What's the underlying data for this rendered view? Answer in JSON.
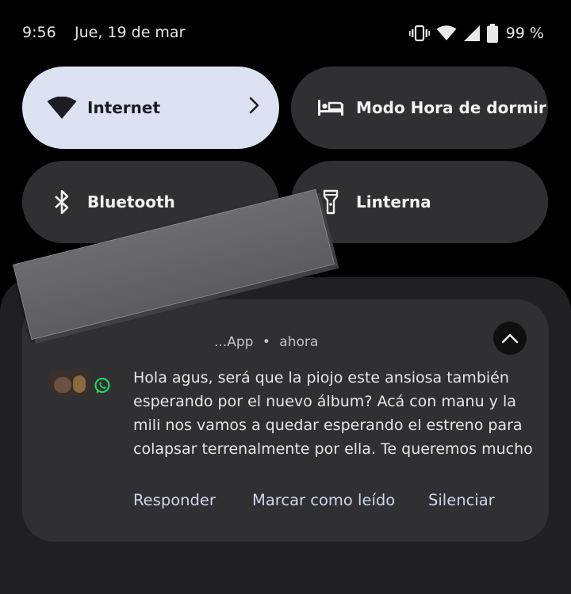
{
  "status_bar": {
    "time": "9:56",
    "date": "Jue, 19 de mar",
    "battery": "99 %",
    "icons": [
      "vibrate-icon",
      "wifi-icon",
      "cell-signal-icon",
      "battery-icon"
    ]
  },
  "quick_tiles": [
    {
      "label": "Internet",
      "icon": "wifi-icon",
      "active": true,
      "has_chevron": true
    },
    {
      "label": "Modo Hora de dormir",
      "icon": "bed-icon",
      "active": false
    },
    {
      "label": "Bluetooth",
      "icon": "bluetooth-icon",
      "active": false
    },
    {
      "label": "Linterna",
      "icon": "flashlight-icon",
      "active": false
    }
  ],
  "notification": {
    "app_fragment": "...App",
    "separator": "•",
    "time": "ahora",
    "app_icon": "whatsapp-icon",
    "body_lines": [
      "Hola agus, será que la piojo este ansiosa también",
      "esperando por el nuevo álbum? Acá con manu y la",
      "mili nos vamos a quedar esperando el estreno para",
      "colapsar terrenalmente por ella. Te queremos mucho"
    ],
    "actions": [
      "Responder",
      "Marcar como leído",
      "Silenciar"
    ]
  },
  "colors": {
    "background": "#000000",
    "tile": "#303032",
    "tile_active": "#dde2f3",
    "panel": "#202022",
    "action_text": "#cfd6ea",
    "whatsapp_green": "#25d366"
  }
}
